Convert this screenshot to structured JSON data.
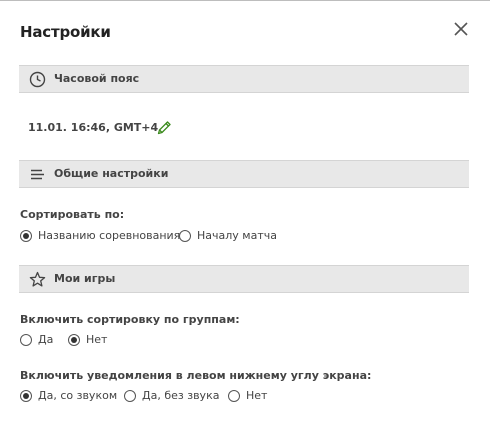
{
  "dialog": {
    "title": "Настройки",
    "close_icon": "close-icon"
  },
  "timezone": {
    "header": "Часовой пояс",
    "icon": "clock-icon",
    "value": "11.01. 16:46, GMT+4",
    "edit_icon": "pencil-icon",
    "edit_color": "#3a8a1c"
  },
  "general": {
    "header": "Общие настройки",
    "icon": "menu-icon",
    "sort_label": "Сортировать по:",
    "sort_options": [
      {
        "label": "Названию соревнования",
        "checked": true
      },
      {
        "label": "Началу матча",
        "checked": false
      }
    ]
  },
  "my_games": {
    "header": "Мои игры",
    "icon": "star-icon",
    "group_sort_label": "Включить сортировку по группам:",
    "group_sort_options": [
      {
        "label": "Да",
        "checked": false
      },
      {
        "label": "Нет",
        "checked": true
      }
    ],
    "notify_label": "Включить уведомления в левом нижнему углу экрана:",
    "notify_options": [
      {
        "label": "Да, со звуком",
        "checked": true
      },
      {
        "label": "Да, без звука",
        "checked": false
      },
      {
        "label": "Нет",
        "checked": false
      }
    ]
  }
}
